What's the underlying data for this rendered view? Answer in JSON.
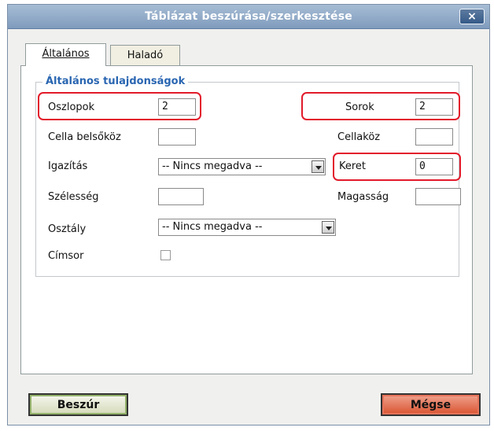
{
  "window": {
    "title": "Táblázat beszúrása/szerkesztése",
    "close_icon": "×"
  },
  "tabs": [
    {
      "label": "Általános",
      "active": true
    },
    {
      "label": "Haladó",
      "active": false
    }
  ],
  "section": {
    "legend": "Általános tulajdonságok"
  },
  "fields": {
    "columns": {
      "label": "Oszlopok",
      "value": "2"
    },
    "rows": {
      "label": "Sorok",
      "value": "2"
    },
    "cellpadding": {
      "label": "Cella belsőköz",
      "value": ""
    },
    "cellspacing": {
      "label": "Cellaköz",
      "value": ""
    },
    "alignment": {
      "label": "Igazítás",
      "value": "-- Nincs megadva --"
    },
    "border": {
      "label": "Keret",
      "value": "0"
    },
    "width": {
      "label": "Szélesség",
      "value": ""
    },
    "height": {
      "label": "Magasság",
      "value": ""
    },
    "class": {
      "label": "Osztály",
      "value": "-- Nincs megadva --"
    },
    "caption": {
      "label": "Címsor",
      "checked": false
    }
  },
  "buttons": {
    "insert": "Beszúr",
    "cancel": "Mégse"
  },
  "colors": {
    "highlight": "#e21b2b",
    "legend": "#2a66b1",
    "titlebar": "#8aa5c6"
  }
}
